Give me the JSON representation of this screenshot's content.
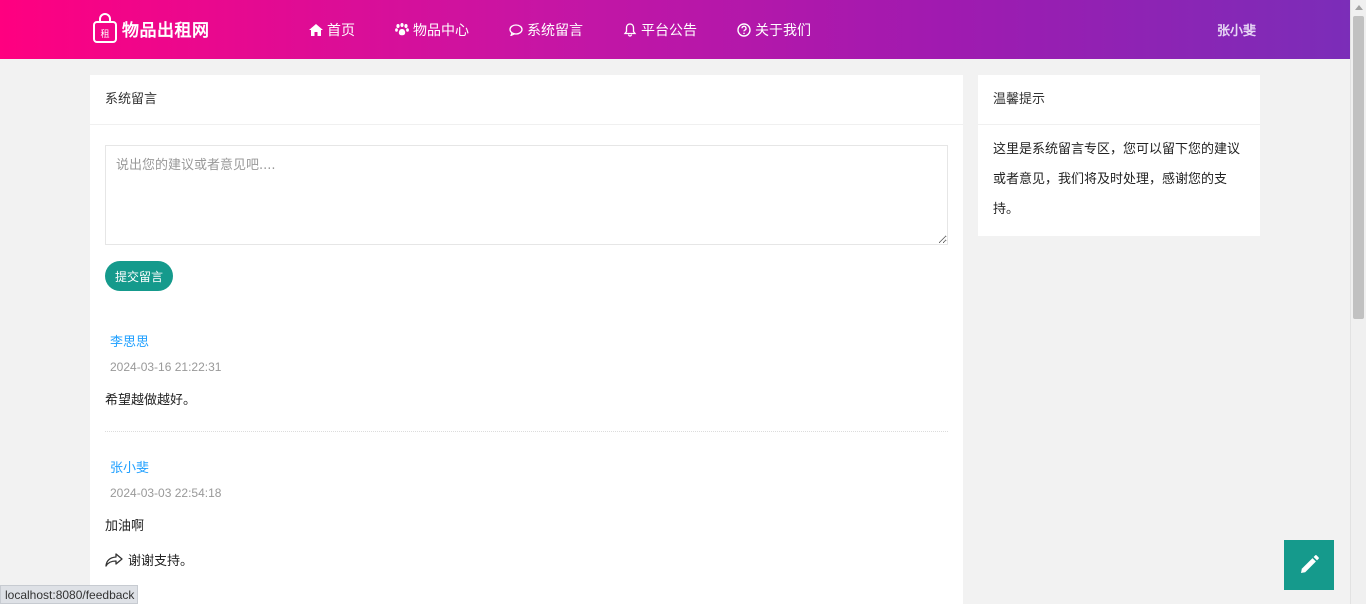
{
  "header": {
    "logo_text": "物品出租网",
    "logo_badge": "租",
    "nav": [
      {
        "label": "首页",
        "icon": "home-icon"
      },
      {
        "label": "物品中心",
        "icon": "paw-icon"
      },
      {
        "label": "系统留言",
        "icon": "comment-icon"
      },
      {
        "label": "平台公告",
        "icon": "bell-icon"
      },
      {
        "label": "关于我们",
        "icon": "question-circle-icon"
      }
    ],
    "user_name": "张小斐"
  },
  "main": {
    "title": "系统留言",
    "textarea_placeholder": "说出您的建议或者意见吧....",
    "submit_label": "提交留言",
    "messages": [
      {
        "user": "李思思",
        "time": "2024-03-16 21:22:31",
        "content": "希望越做越好。"
      },
      {
        "user": "张小斐",
        "time": "2024-03-03 22:54:18",
        "content": "加油啊",
        "reply": "谢谢支持。"
      }
    ]
  },
  "side": {
    "title": "温馨提示",
    "content": "这里是系统留言专区，您可以留下您的建议或者意见，我们将及时处理，感谢您的支持。"
  },
  "status_url": "localhost:8080/feedback",
  "colors": {
    "header_gradient_start": "#ff0080",
    "header_gradient_end": "#7b2db8",
    "accent": "#159a8c",
    "user_link": "#1e9fff"
  }
}
